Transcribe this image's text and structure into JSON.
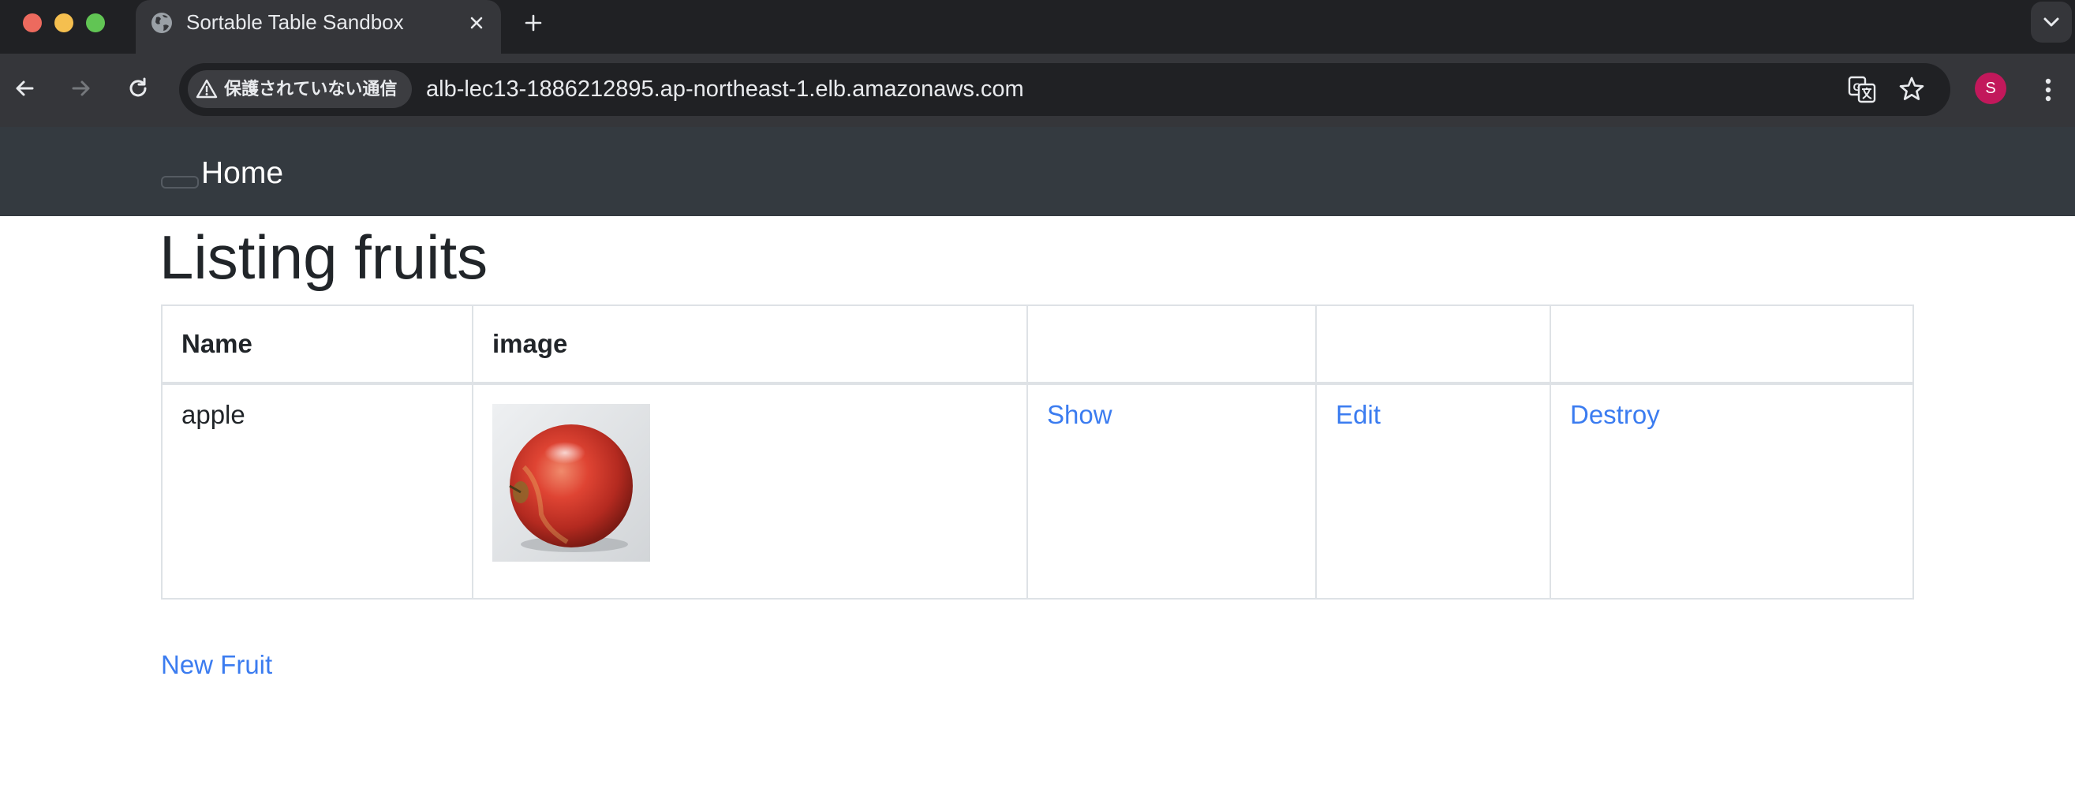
{
  "browser": {
    "tab_title": "Sortable Table Sandbox",
    "security_label": "保護されていない通信",
    "url": "alb-lec13-1886212895.ap-northeast-1.elb.amazonaws.com",
    "profile_initial": "S",
    "icons": [
      "globe-icon",
      "close-icon",
      "plus-icon",
      "chevron-down-icon",
      "back-icon",
      "forward-icon",
      "reload-icon",
      "warning-icon",
      "translate-icon",
      "star-icon",
      "kebab-menu-icon"
    ]
  },
  "navbar": {
    "brand": "Home"
  },
  "page": {
    "title": "Listing fruits",
    "table": {
      "headers": [
        "Name",
        "image",
        "",
        "",
        ""
      ],
      "rows": [
        {
          "name": "apple",
          "show": "Show",
          "edit": "Edit",
          "destroy": "Destroy"
        }
      ]
    },
    "new_link": "New Fruit"
  },
  "colors": {
    "navbar_bg": "#343a40",
    "link": "#3b7cf0",
    "text": "#212529",
    "avatar": "#c2185b"
  }
}
